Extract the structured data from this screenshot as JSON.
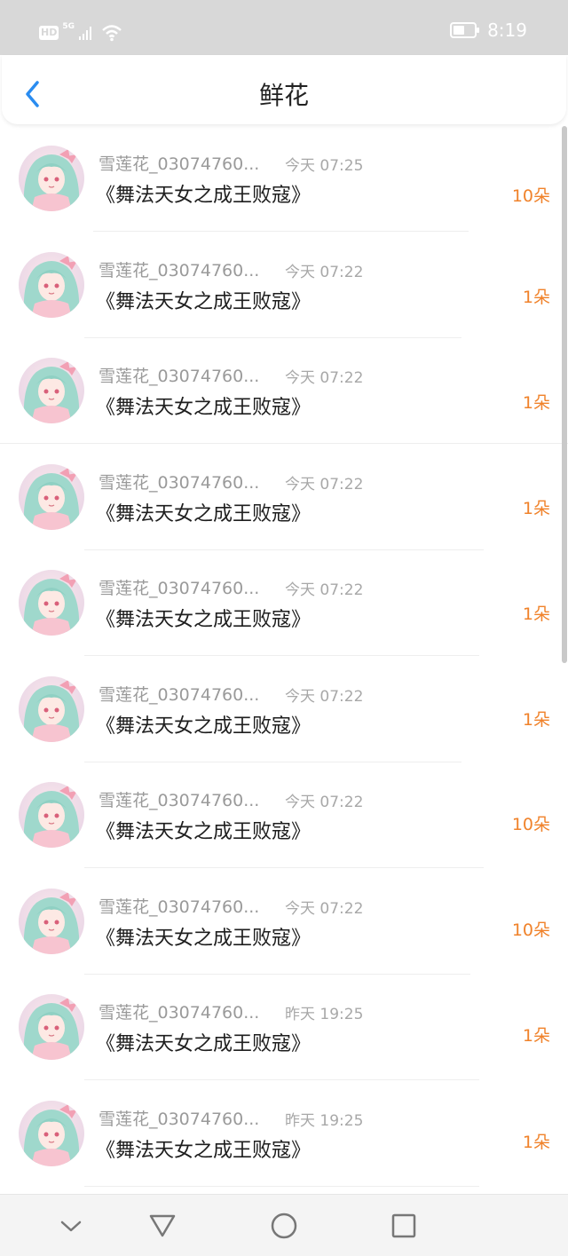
{
  "status": {
    "hd": "HD",
    "net": "5G",
    "time": "8:19"
  },
  "header": {
    "title": "鲜花",
    "back_icon": "back-chevron-icon"
  },
  "colors": {
    "accent": "#2a8cf0",
    "count": "#f0822a",
    "status_bg": "#d8d8d8"
  },
  "rows": [
    {
      "name": "雪莲花_03074760...",
      "time": "今天 07:25",
      "book": "《舞法天女之成王败寇》",
      "count": "10朵"
    },
    {
      "name": "雪莲花_03074760...",
      "time": "今天 07:22",
      "book": "《舞法天女之成王败寇》",
      "count": "1朵"
    },
    {
      "name": "雪莲花_03074760...",
      "time": "今天 07:22",
      "book": "《舞法天女之成王败寇》",
      "count": "1朵"
    },
    {
      "name": "雪莲花_03074760...",
      "time": "今天 07:22",
      "book": "《舞法天女之成王败寇》",
      "count": "1朵"
    },
    {
      "name": "雪莲花_03074760...",
      "time": "今天 07:22",
      "book": "《舞法天女之成王败寇》",
      "count": "1朵"
    },
    {
      "name": "雪莲花_03074760...",
      "time": "今天 07:22",
      "book": "《舞法天女之成王败寇》",
      "count": "1朵"
    },
    {
      "name": "雪莲花_03074760...",
      "time": "今天 07:22",
      "book": "《舞法天女之成王败寇》",
      "count": "10朵"
    },
    {
      "name": "雪莲花_03074760...",
      "time": "今天 07:22",
      "book": "《舞法天女之成王败寇》",
      "count": "10朵"
    },
    {
      "name": "雪莲花_03074760...",
      "time": "昨天 19:25",
      "book": "《舞法天女之成王败寇》",
      "count": "1朵"
    },
    {
      "name": "雪莲花_03074760...",
      "time": "昨天 19:25",
      "book": "《舞法天女之成王败寇》",
      "count": "1朵"
    }
  ],
  "navbar": {
    "icons": [
      "collapse-icon",
      "back-triangle-icon",
      "home-circle-icon",
      "recents-square-icon"
    ]
  }
}
